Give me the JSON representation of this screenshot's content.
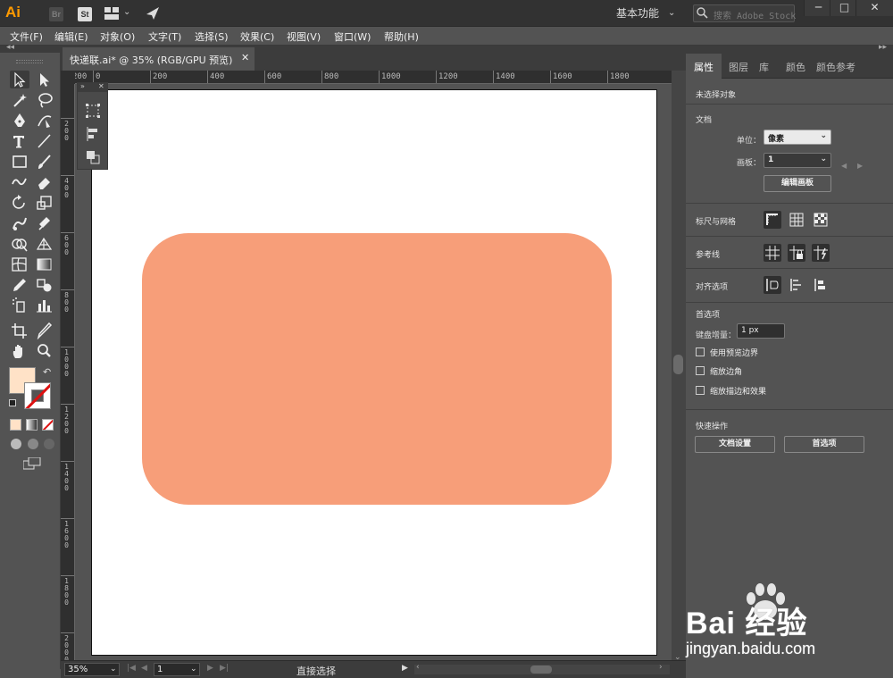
{
  "app": {
    "logo": "Ai",
    "bridge_badge": "Br",
    "stock_badge": "St",
    "workspace": "基本功能",
    "stock_search_placeholder": "搜索 Adobe Stock",
    "window_controls": [
      "─",
      "□",
      "✕"
    ]
  },
  "menu": [
    "文件(F)",
    "编辑(E)",
    "对象(O)",
    "文字(T)",
    "选择(S)",
    "效果(C)",
    "视图(V)",
    "窗口(W)",
    "帮助(H)"
  ],
  "document_tab": {
    "title": "快递联.ai* @ 35% (RGB/GPU 预览)",
    "close": "✕"
  },
  "ruler": {
    "top_labels": [
      "200",
      "0",
      "200",
      "400",
      "600",
      "800",
      "1000",
      "1200",
      "1400",
      "1600",
      "1800"
    ],
    "left_labels": [
      "200",
      "400",
      "600",
      "800",
      "1000",
      "1200",
      "1400",
      "1600",
      "1800",
      "2000"
    ]
  },
  "canvas": {
    "shape_fill": "#f79e79",
    "fill_color": "#ffe2c7",
    "stroke_color": "none"
  },
  "status": {
    "zoom": "35%",
    "artboard": "1",
    "current_tool": "直接选择"
  },
  "panel_tabs": [
    "属性",
    "图层",
    "库",
    "颜色",
    "颜色参考"
  ],
  "properties": {
    "selection_state": "未选择对象",
    "document_title": "文档",
    "unit_label": "单位：",
    "unit_value": "像素",
    "artboard_label": "画板：",
    "artboard_value": "1",
    "edit_artboards_button": "编辑画板",
    "rulers_grids_title": "标尺与网格",
    "guides_title": "参考线",
    "align_title": "对齐选项",
    "preferences_title": "首选项",
    "keyboard_increment_label": "键盘增量：",
    "keyboard_increment_value": "1 px",
    "checkboxes": [
      "使用预览边界",
      "缩放边角",
      "缩放描边和效果"
    ],
    "quick_actions_title": "快速操作",
    "document_setup_button": "文档设置",
    "preferences_button": "首选项"
  },
  "watermark": {
    "brand": "Bai 经验",
    "domain": "jingyan.baidu.com"
  }
}
